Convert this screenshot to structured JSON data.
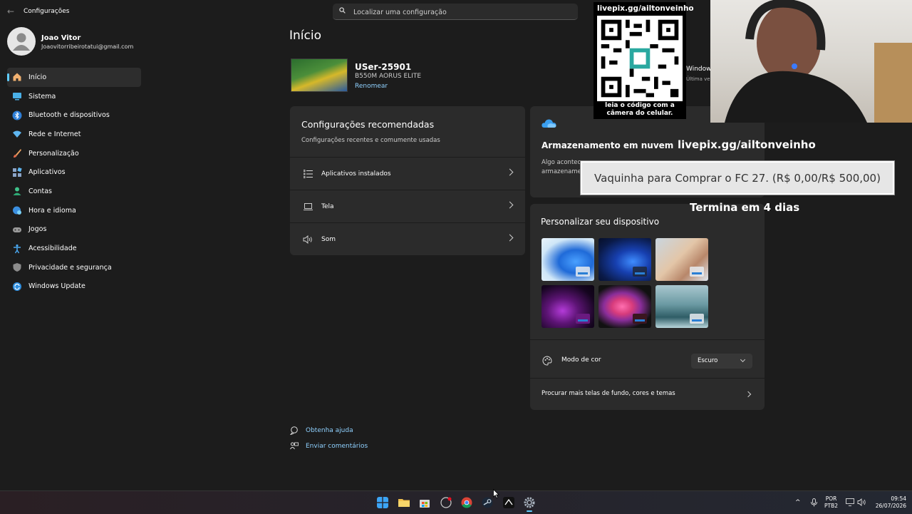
{
  "window": {
    "title": "Configurações"
  },
  "search": {
    "placeholder": "Localizar uma configuração"
  },
  "profile": {
    "name": "Joao Vitor",
    "email": "Joaovitorribeirotatui@gmail.com"
  },
  "nav": {
    "items": [
      {
        "label": "Início",
        "icon": "home-icon",
        "active": true
      },
      {
        "label": "Sistema",
        "icon": "monitor-icon"
      },
      {
        "label": "Bluetooth e dispositivos",
        "icon": "bluetooth-icon"
      },
      {
        "label": "Rede e Internet",
        "icon": "wifi-icon"
      },
      {
        "label": "Personalização",
        "icon": "brush-icon"
      },
      {
        "label": "Aplicativos",
        "icon": "apps-icon"
      },
      {
        "label": "Contas",
        "icon": "person-icon"
      },
      {
        "label": "Hora e idioma",
        "icon": "globe-clock-icon"
      },
      {
        "label": "Jogos",
        "icon": "gamepad-icon"
      },
      {
        "label": "Acessibilidade",
        "icon": "accessibility-icon"
      },
      {
        "label": "Privacidade e segurança",
        "icon": "shield-icon"
      },
      {
        "label": "Windows Update",
        "icon": "update-icon"
      }
    ]
  },
  "main": {
    "title": "Início",
    "device": {
      "name": "USer-25901",
      "model": "B550M AORUS ELITE",
      "rename": "Renomear"
    },
    "recommended": {
      "title": "Configurações recomendadas",
      "subtitle": "Configurações recentes e comumente usadas",
      "rows": [
        {
          "label": "Aplicativos instalados",
          "icon": "list-icon"
        },
        {
          "label": "Tela",
          "icon": "laptop-icon"
        },
        {
          "label": "Som",
          "icon": "speaker-icon"
        }
      ]
    },
    "cloud": {
      "title": "Armazenamento em nuvem",
      "text1": "Algo acontec",
      "text2": "armazename"
    },
    "personalize": {
      "title": "Personalizar seu dispositivo",
      "color_mode_label": "Modo de cor",
      "color_mode_value": "Escuro",
      "more": "Procurar mais telas de fundo, cores e temas"
    },
    "help": {
      "get_help": "Obtenha ajuda",
      "feedback": "Enviar comentários"
    },
    "windows_peek": {
      "title": "Window",
      "sub": "Última ve"
    }
  },
  "overlay": {
    "qr_top": "livepix.gg/ailtonveinho",
    "qr_bottom_1": "leia o código com a",
    "qr_bottom_2": "câmera do celular.",
    "pix_title": "livepix.gg/ailtonveinho",
    "goal": "Vaquinha para Comprar o FC 27. (R$ 0,00/R$ 500,00)",
    "goal_progress": 0,
    "ends": "Termina em 4 dias"
  },
  "taskbar": {
    "lang1": "POR",
    "lang2": "PTB2",
    "time": "09:54",
    "date": "26/07/2026"
  }
}
